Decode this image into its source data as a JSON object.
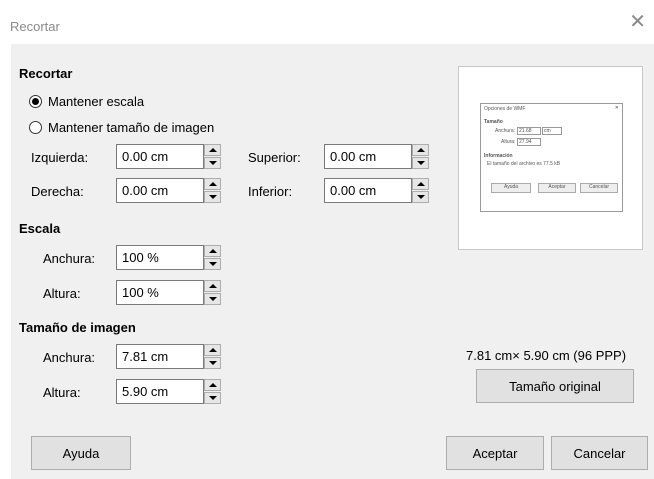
{
  "window": {
    "title": "Recortar"
  },
  "crop": {
    "heading": "Recortar",
    "keep_scale": "Mantener escala",
    "keep_size": "Mantener tamaño de imagen",
    "left_label": "Izquierda:",
    "left_value": "0.00 cm",
    "right_label": "Derecha:",
    "right_value": "0.00 cm",
    "top_label": "Superior:",
    "top_value": "0.00 cm",
    "bottom_label": "Inferior:",
    "bottom_value": "0.00 cm",
    "selected": "keep_scale"
  },
  "scale": {
    "heading": "Escala",
    "width_label": "Anchura:",
    "width_value": "100 %",
    "height_label": "Altura:",
    "height_value": "100 %"
  },
  "image_size": {
    "heading": "Tamaño de imagen",
    "width_label": "Anchura:",
    "width_value": "7.81 cm",
    "height_label": "Altura:",
    "height_value": "5.90 cm"
  },
  "preview": {
    "info": "7.81 cm× 5.90 cm (96 PPP)",
    "original_size_button": "Tamaño original",
    "thumbnail": {
      "title": "Opciones de WMF",
      "size_heading": "Tamaño",
      "width_label": "Anchura:",
      "width_value": "21.68",
      "unit": "cm",
      "height_label": "Altura:",
      "height_value": "27.94",
      "info_heading": "Información",
      "info_text": "El tamaño del archivo es 77.5 kB",
      "help": "Ayuda",
      "ok": "Aceptar",
      "cancel": "Cancelar"
    }
  },
  "buttons": {
    "help": "Ayuda",
    "ok": "Aceptar",
    "cancel": "Cancelar"
  }
}
